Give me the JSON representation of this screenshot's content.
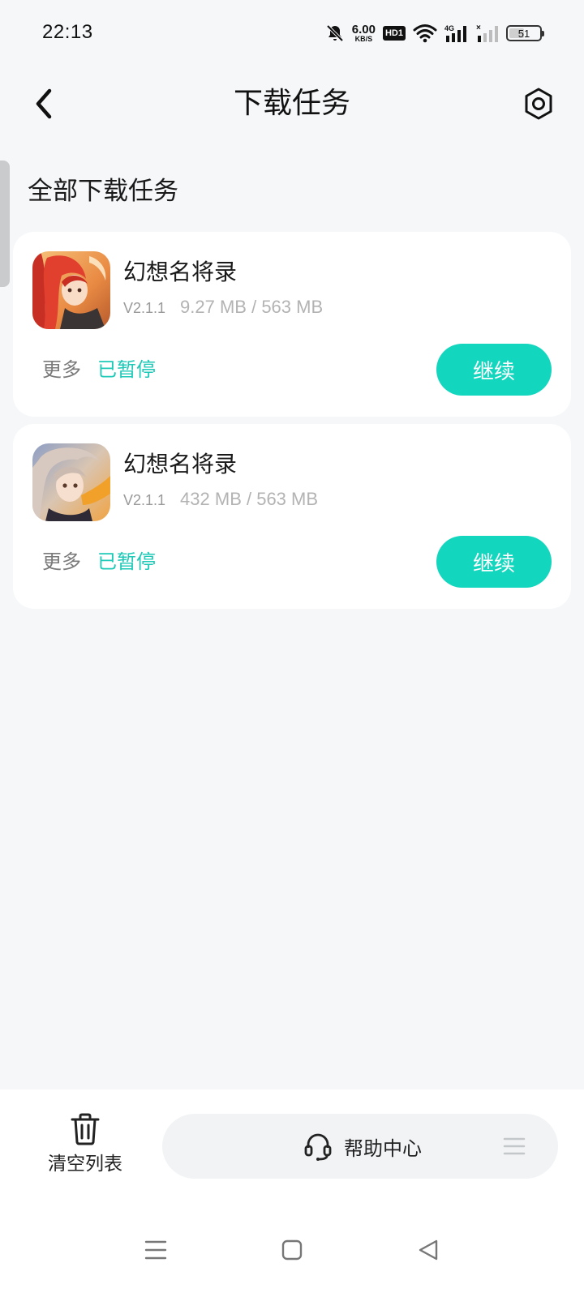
{
  "status_bar": {
    "time": "22:13",
    "net_speed_value": "6.00",
    "net_speed_unit": "KB/S",
    "hd_badge": "HD1",
    "network_type": "4G",
    "battery_level": "51",
    "battery_fraction": 0.51,
    "icons": [
      "mute-bell-icon",
      "wifi-icon",
      "signal-icon",
      "signal-empty-icon",
      "battery-icon"
    ]
  },
  "header": {
    "title": "下载任务",
    "back_icon": "chevron-left-icon",
    "settings_icon": "hexagon-settings-icon"
  },
  "section_title": "全部下载任务",
  "tasks": [
    {
      "name": "幻想名将录",
      "version": "V2.1.1",
      "size": "9.27 MB / 563 MB",
      "more": "更多",
      "status": "已暂停",
      "action": "继续"
    },
    {
      "name": "幻想名将录",
      "version": "V2.1.1",
      "size": "432 MB / 563 MB",
      "more": "更多",
      "status": "已暂停",
      "action": "继续"
    }
  ],
  "bottom_bar": {
    "clear_label": "清空列表",
    "clear_icon": "trash-icon",
    "help_label": "帮助中心",
    "help_icon": "headset-icon",
    "menu_icon": "menu-lines-icon"
  },
  "colors": {
    "accent": "#12d6bd",
    "status_text": "#1ec9b7",
    "background": "#f5f7f9",
    "card": "#ffffff"
  }
}
